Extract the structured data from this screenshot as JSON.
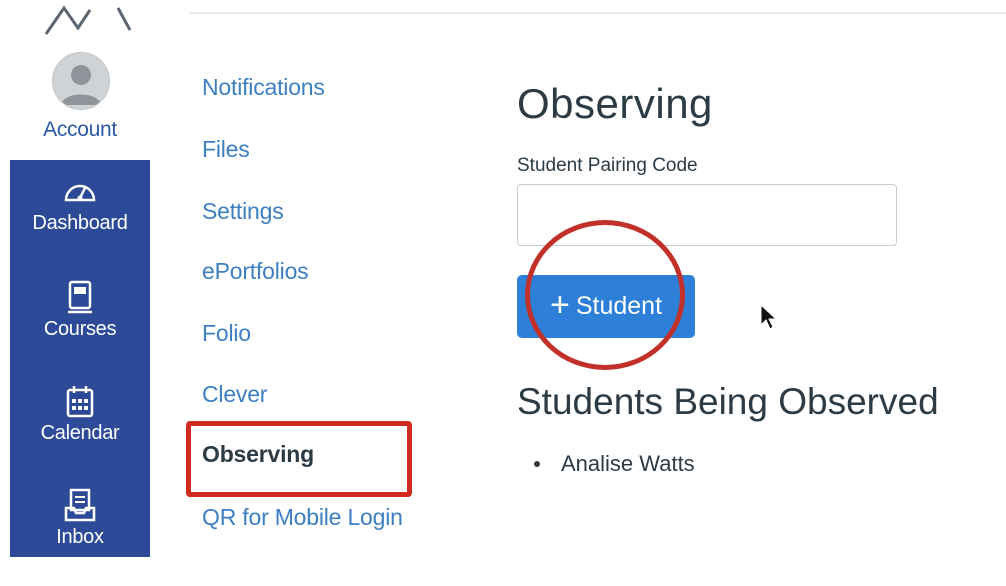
{
  "global_nav": {
    "account_label": "Account",
    "items": [
      {
        "label": "Dashboard",
        "icon": "dashboard-icon"
      },
      {
        "label": "Courses",
        "icon": "courses-icon"
      },
      {
        "label": "Calendar",
        "icon": "calendar-icon"
      },
      {
        "label": "Inbox",
        "icon": "inbox-icon"
      }
    ]
  },
  "sub_nav": {
    "links": [
      {
        "label": "Notifications"
      },
      {
        "label": "Files"
      },
      {
        "label": "Settings"
      },
      {
        "label": "ePortfolios"
      },
      {
        "label": "Folio"
      },
      {
        "label": "Clever"
      },
      {
        "label": "Observing",
        "active": true
      },
      {
        "label": "QR for Mobile Login"
      }
    ]
  },
  "main": {
    "title": "Observing",
    "pairing_code_label": "Student Pairing Code",
    "pairing_code_value": "",
    "add_student_button": "Student",
    "add_student_icon": "+",
    "observed_heading": "Students Being Observed",
    "observed_students": [
      "Analise Watts"
    ]
  },
  "colors": {
    "nav_blue": "#2c4a97",
    "link_blue": "#3d7fc1",
    "button_blue": "#2d7fd8",
    "annotation_red": "#d12a1f"
  }
}
